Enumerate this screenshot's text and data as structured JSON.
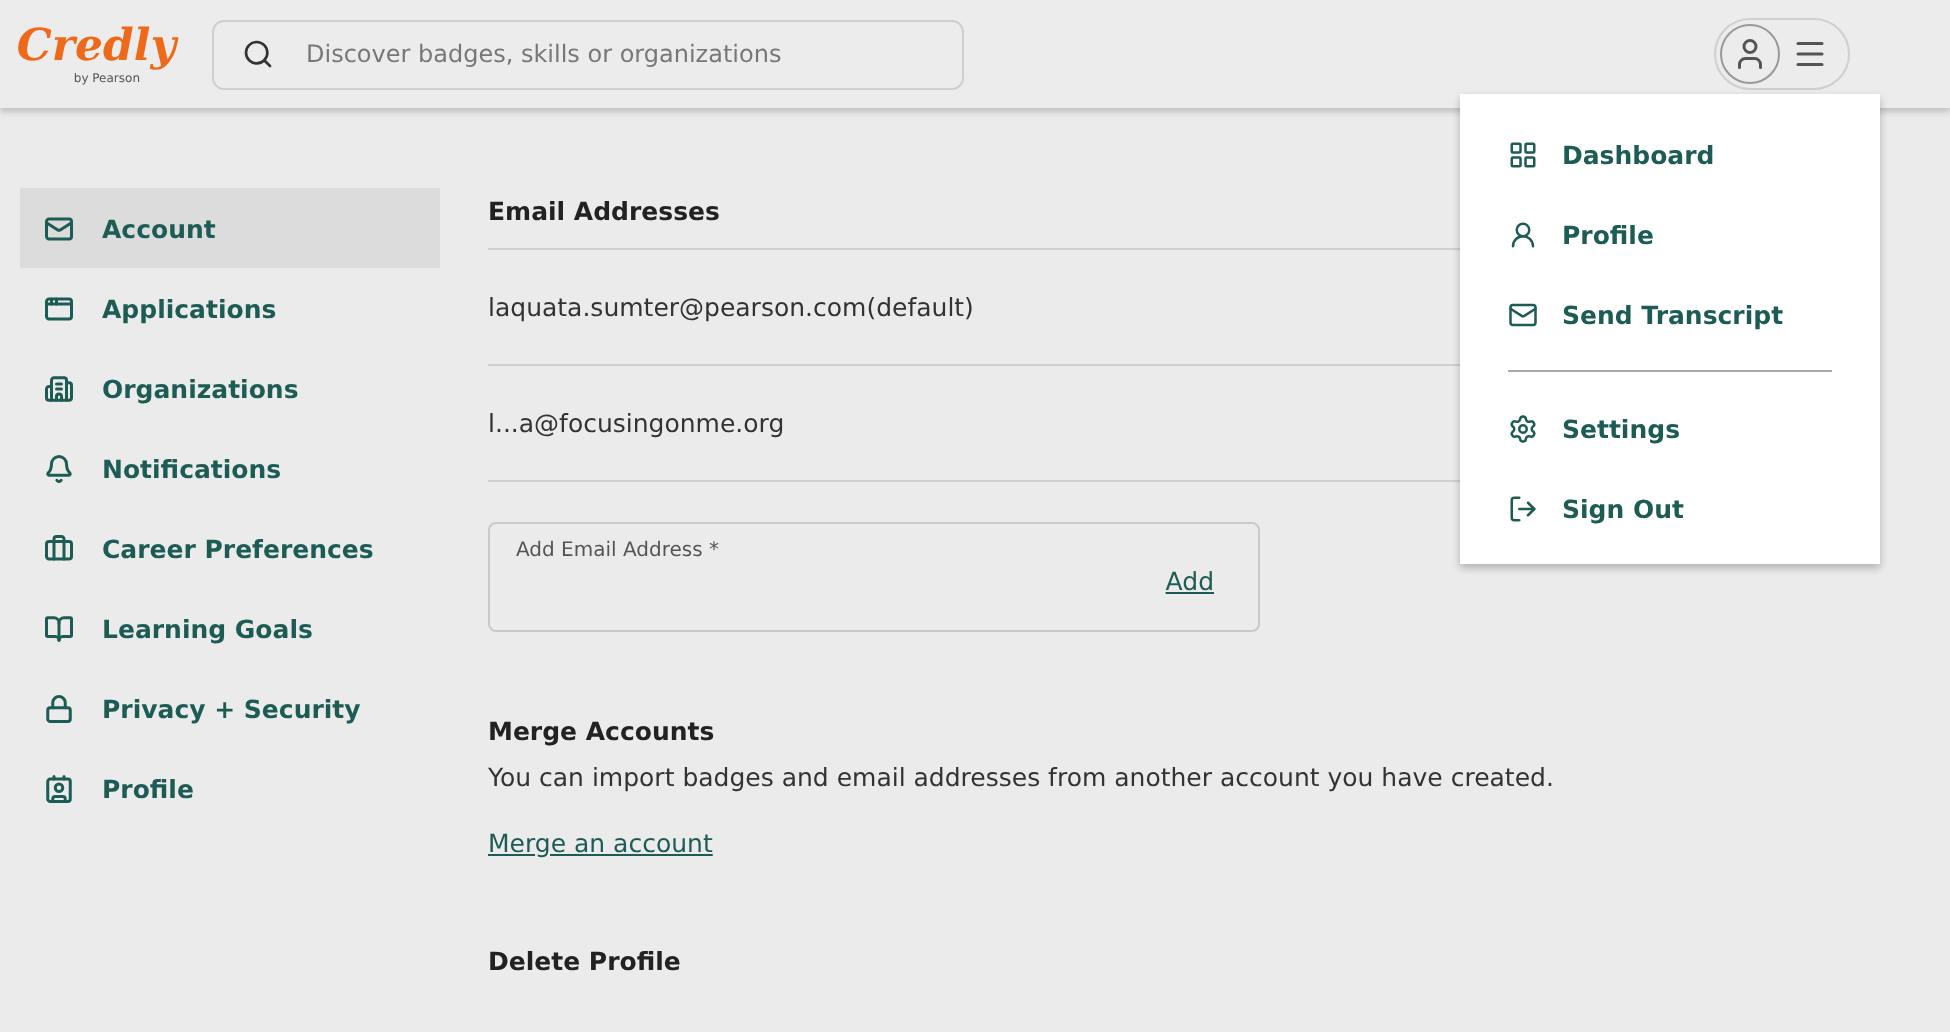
{
  "header": {
    "logo": "Credly",
    "logo_sub": "by Pearson",
    "search": {
      "placeholder": "Discover badges, skills or organizations"
    }
  },
  "sidebar": {
    "items": [
      {
        "label": "Account",
        "selected": true
      },
      {
        "label": "Applications",
        "selected": false
      },
      {
        "label": "Organizations",
        "selected": false
      },
      {
        "label": "Notifications",
        "selected": false
      },
      {
        "label": "Career Preferences",
        "selected": false
      },
      {
        "label": "Learning Goals",
        "selected": false
      },
      {
        "label": "Privacy + Security",
        "selected": false
      },
      {
        "label": "Profile",
        "selected": false
      }
    ]
  },
  "email_section": {
    "title": "Email Addresses",
    "emails": [
      "laquata.sumter@pearson.com(default)",
      "l...a@focusingonme.org"
    ],
    "add_field": {
      "label": "Add Email Address *",
      "action": "Add"
    }
  },
  "merge_section": {
    "title": "Merge Accounts",
    "text": "You can import badges and email addresses from another account you have created.",
    "link": "Merge an account"
  },
  "delete_section": {
    "title": "Delete Profile"
  },
  "user_menu": {
    "groups": [
      [
        "Dashboard",
        "Profile",
        "Send Transcript"
      ],
      [
        "Settings",
        "Sign Out"
      ]
    ]
  }
}
